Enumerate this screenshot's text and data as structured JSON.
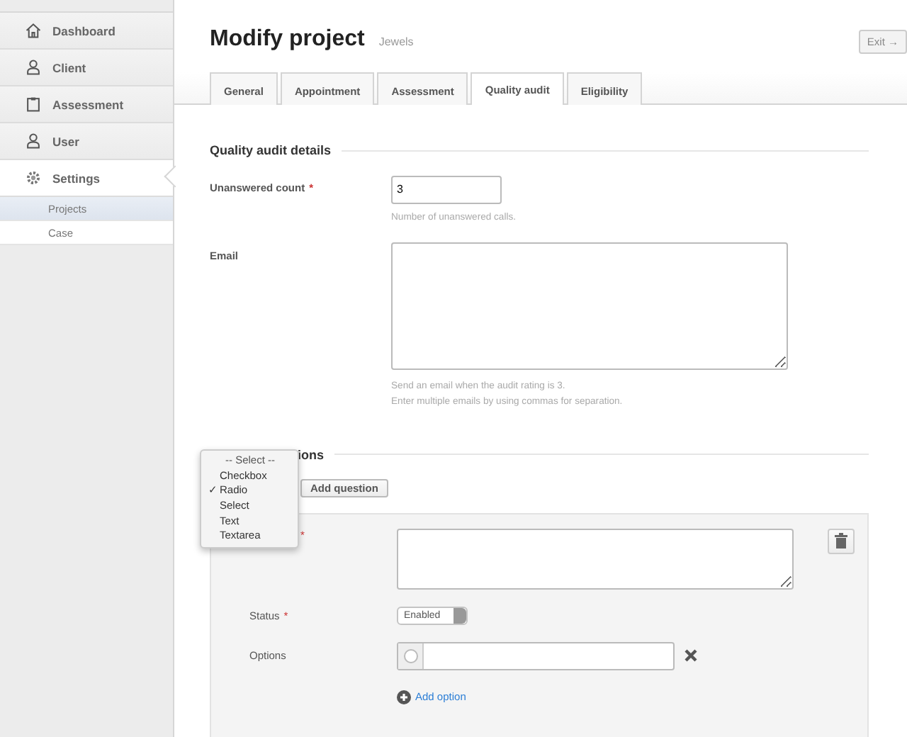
{
  "sidebar": {
    "items": [
      {
        "label": "Dashboard",
        "kind": "house",
        "selected": false
      },
      {
        "label": "Client",
        "kind": "person",
        "selected": false
      },
      {
        "label": "Assessment",
        "kind": "clipboard",
        "selected": false
      },
      {
        "label": "User",
        "kind": "person",
        "selected": false
      },
      {
        "label": "Settings",
        "kind": "gear",
        "selected": true,
        "children": [
          {
            "label": "Projects",
            "selected": true
          },
          {
            "label": "Case",
            "selected": false
          }
        ]
      }
    ]
  },
  "header": {
    "title": "Modify project",
    "subtitle": "Jewels",
    "exit_button": "Exit →"
  },
  "tabs": [
    {
      "label": "General",
      "selected": false
    },
    {
      "label": "Appointment",
      "selected": false
    },
    {
      "label": "Assessment",
      "selected": false
    },
    {
      "label": "Quality audit",
      "selected": true
    },
    {
      "label": "Eligibility",
      "selected": false
    }
  ],
  "details": {
    "heading": "Quality audit details",
    "unanswered": {
      "label": "Unanswered count",
      "required": true,
      "value": "3",
      "help": [
        "Number of unanswered calls."
      ]
    },
    "email": {
      "label": "Email",
      "help": [
        "Send an email when the audit rating is 3.",
        "Enter multiple emails by using commas for separation."
      ]
    }
  },
  "questions": {
    "heading": "ions",
    "check_mark": "✓",
    "add_button": "Add question",
    "type_menu": [
      {
        "label": "-- Select --",
        "selected": false
      },
      {
        "label": "Checkbox",
        "selected": false
      },
      {
        "label": "Radio",
        "selected": true
      },
      {
        "label": "Select",
        "selected": false
      },
      {
        "label": "Text",
        "selected": false
      },
      {
        "label": "Textarea",
        "selected": false
      }
    ],
    "question": {
      "required_mark": "*",
      "status": {
        "label": "Status",
        "required": true,
        "value": "Enabled"
      },
      "options": {
        "label": "Options",
        "add_link": "Add option"
      }
    }
  }
}
